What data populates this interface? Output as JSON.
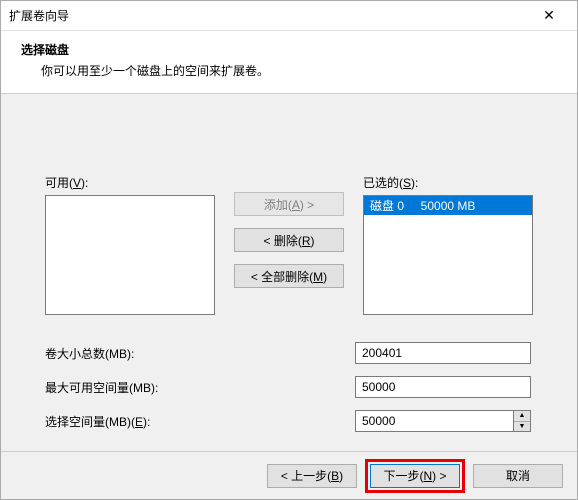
{
  "window": {
    "title": "扩展卷向导",
    "close": "✕"
  },
  "header": {
    "heading": "选择磁盘",
    "desc": "你可以用至少一个磁盘上的空间来扩展卷。"
  },
  "lists": {
    "available_label_pre": "可用(",
    "available_label_key": "V",
    "available_label_post": "):",
    "selected_label_pre": "已选的(",
    "selected_label_key": "S",
    "selected_label_post": "):",
    "selected_item": "磁盘 0     50000 MB"
  },
  "buttons": {
    "add_pre": "添加(",
    "add_key": "A",
    "add_post": ") >",
    "remove_pre": "< 删除(",
    "remove_key": "R",
    "remove_post": ")",
    "remove_all_pre": "< 全部删除(",
    "remove_all_key": "M",
    "remove_all_post": ")"
  },
  "fields": {
    "total_label": "卷大小总数(MB):",
    "total_value": "200401",
    "max_label": "最大可用空间量(MB):",
    "max_value": "50000",
    "select_label_pre": "选择空间量(MB)(",
    "select_label_key": "E",
    "select_label_post": "):",
    "select_value": "50000"
  },
  "footer": {
    "back_pre": "< 上一步(",
    "back_key": "B",
    "back_post": ")",
    "next_pre": "下一步(",
    "next_key": "N",
    "next_post": ") >",
    "cancel": "取消"
  }
}
